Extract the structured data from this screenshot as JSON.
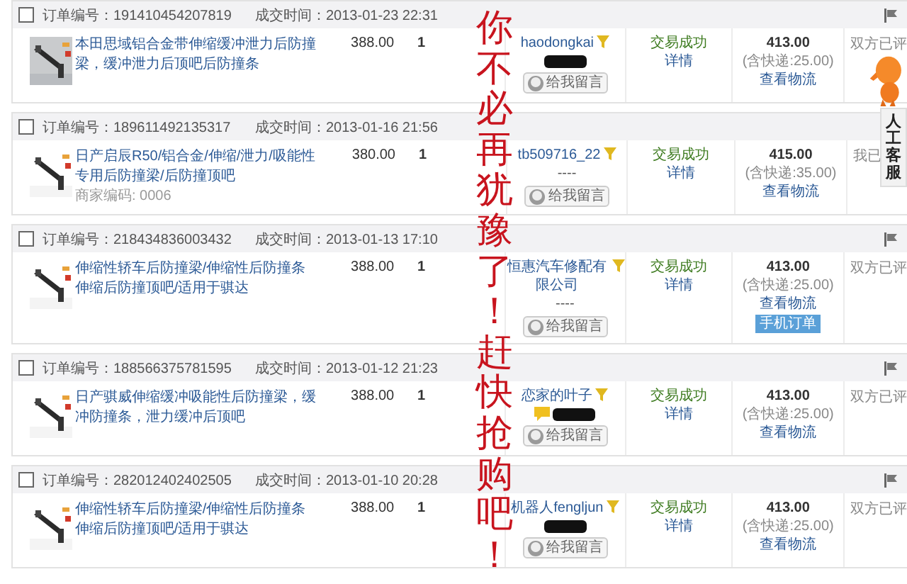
{
  "orders": [
    {
      "checked": false,
      "order_no": "订单编号：191410454207819",
      "time": "成交时间：2013-01-23 22:31",
      "flag": true,
      "item": {
        "title": "本田思域铝合金带伸缩缓冲泄力后防撞梁，缓冲泄力后顶吧后防撞条",
        "price": "388.00",
        "qty": "1"
      },
      "seller": {
        "name": "haodongkai",
        "contact": {
          "kind": "hidden"
        },
        "message_button": "给我留言"
      },
      "status": {
        "text": "交易成功",
        "details": "详情"
      },
      "total": {
        "amount": "413.00",
        "shipping": "(含快递:25.00)",
        "logistics": "查看物流"
      },
      "review": "双方已评"
    },
    {
      "checked": false,
      "order_no": "订单编号：189611492135317",
      "time": "成交时间：2013-01-16 21:56",
      "flag": false,
      "item": {
        "title": "日产启辰R50/铝合金/伸缩/泄力/吸能性专用后防撞梁/后防撞顶吧",
        "code": "商家编码: 0006",
        "price": "380.00",
        "qty": "1"
      },
      "seller": {
        "name": "tb509716_22",
        "contact": {
          "kind": "text",
          "text": "----"
        },
        "message_button": "给我留言"
      },
      "status": {
        "text": "交易成功",
        "details": "详情"
      },
      "total": {
        "amount": "415.00",
        "shipping": "(含快递:35.00)",
        "logistics": "查看物流"
      },
      "review": "我已"
    },
    {
      "checked": false,
      "order_no": "订单编号：218434836003432",
      "time": "成交时间：2013-01-13 17:10",
      "flag": true,
      "item": {
        "title": "伸缩性轿车后防撞梁/伸缩性后防撞条伸缩后防撞顶吧/适用于骐达",
        "price": "388.00",
        "qty": "1"
      },
      "seller": {
        "name": "恒惠汽车修配有限公司",
        "contact": {
          "kind": "text",
          "text": "----"
        },
        "message_button": "给我留言"
      },
      "status": {
        "text": "交易成功",
        "details": "详情"
      },
      "total": {
        "amount": "413.00",
        "shipping": "(含快递:25.00)",
        "logistics": "查看物流",
        "extra_button": "手机订单"
      },
      "review": "双方已评"
    },
    {
      "checked": false,
      "order_no": "订单编号：188566375781595",
      "time": "成交时间：2013-01-12 21:23",
      "flag": true,
      "item": {
        "title": "日产骐威伸缩缓冲吸能性后防撞梁，缓冲防撞条，泄力缓冲后顶吧",
        "price": "388.00",
        "qty": "1"
      },
      "seller": {
        "name": "恋家的叶子",
        "contact": {
          "kind": "chat_hidden"
        },
        "message_button": "给我留言"
      },
      "status": {
        "text": "交易成功",
        "details": "详情"
      },
      "total": {
        "amount": "413.00",
        "shipping": "(含快递:25.00)",
        "logistics": "查看物流"
      },
      "review": "双方已评"
    },
    {
      "checked": false,
      "order_no": "订单编号：282012402402505",
      "time": "成交时间：2013-01-10 20:28",
      "flag": true,
      "item": {
        "title": "伸缩性轿车后防撞梁/伸缩性后防撞条伸缩后防撞顶吧/适用于骐达",
        "price": "388.00",
        "qty": "1"
      },
      "seller": {
        "name": "机器人fengljun",
        "contact": {
          "kind": "hidden"
        },
        "message_button": "给我留言"
      },
      "status": {
        "text": "交易成功",
        "details": "详情"
      },
      "total": {
        "amount": "413.00",
        "shipping": "(含快递:25.00)",
        "logistics": "查看物流"
      },
      "review": "双方已评"
    }
  ],
  "overlay": {
    "text": "你不必再犹豫了！赶快抢购吧！"
  },
  "service_widget": {
    "label": "人工客服"
  }
}
